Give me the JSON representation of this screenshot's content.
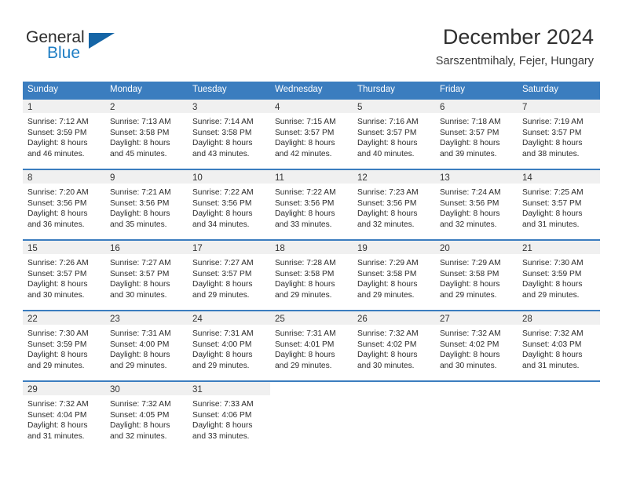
{
  "brand": {
    "name_part1": "General",
    "name_part2": "Blue",
    "logo_icon": "triangle-logo-icon",
    "accent_color": "#1f7ec4"
  },
  "header": {
    "title": "December 2024",
    "location": "Sarszentmihaly, Fejer, Hungary"
  },
  "colors": {
    "header_row_bg": "#3b7dbf",
    "day_band_bg": "#f0f0f0",
    "row_divider": "#3b7dbf",
    "text": "#2b2b2b"
  },
  "weekdays": [
    "Sunday",
    "Monday",
    "Tuesday",
    "Wednesday",
    "Thursday",
    "Friday",
    "Saturday"
  ],
  "weeks": [
    {
      "days": [
        {
          "date": "1",
          "sunrise": "Sunrise: 7:12 AM",
          "sunset": "Sunset: 3:59 PM",
          "daylight_l1": "Daylight: 8 hours",
          "daylight_l2": "and 46 minutes."
        },
        {
          "date": "2",
          "sunrise": "Sunrise: 7:13 AM",
          "sunset": "Sunset: 3:58 PM",
          "daylight_l1": "Daylight: 8 hours",
          "daylight_l2": "and 45 minutes."
        },
        {
          "date": "3",
          "sunrise": "Sunrise: 7:14 AM",
          "sunset": "Sunset: 3:58 PM",
          "daylight_l1": "Daylight: 8 hours",
          "daylight_l2": "and 43 minutes."
        },
        {
          "date": "4",
          "sunrise": "Sunrise: 7:15 AM",
          "sunset": "Sunset: 3:57 PM",
          "daylight_l1": "Daylight: 8 hours",
          "daylight_l2": "and 42 minutes."
        },
        {
          "date": "5",
          "sunrise": "Sunrise: 7:16 AM",
          "sunset": "Sunset: 3:57 PM",
          "daylight_l1": "Daylight: 8 hours",
          "daylight_l2": "and 40 minutes."
        },
        {
          "date": "6",
          "sunrise": "Sunrise: 7:18 AM",
          "sunset": "Sunset: 3:57 PM",
          "daylight_l1": "Daylight: 8 hours",
          "daylight_l2": "and 39 minutes."
        },
        {
          "date": "7",
          "sunrise": "Sunrise: 7:19 AM",
          "sunset": "Sunset: 3:57 PM",
          "daylight_l1": "Daylight: 8 hours",
          "daylight_l2": "and 38 minutes."
        }
      ]
    },
    {
      "days": [
        {
          "date": "8",
          "sunrise": "Sunrise: 7:20 AM",
          "sunset": "Sunset: 3:56 PM",
          "daylight_l1": "Daylight: 8 hours",
          "daylight_l2": "and 36 minutes."
        },
        {
          "date": "9",
          "sunrise": "Sunrise: 7:21 AM",
          "sunset": "Sunset: 3:56 PM",
          "daylight_l1": "Daylight: 8 hours",
          "daylight_l2": "and 35 minutes."
        },
        {
          "date": "10",
          "sunrise": "Sunrise: 7:22 AM",
          "sunset": "Sunset: 3:56 PM",
          "daylight_l1": "Daylight: 8 hours",
          "daylight_l2": "and 34 minutes."
        },
        {
          "date": "11",
          "sunrise": "Sunrise: 7:22 AM",
          "sunset": "Sunset: 3:56 PM",
          "daylight_l1": "Daylight: 8 hours",
          "daylight_l2": "and 33 minutes."
        },
        {
          "date": "12",
          "sunrise": "Sunrise: 7:23 AM",
          "sunset": "Sunset: 3:56 PM",
          "daylight_l1": "Daylight: 8 hours",
          "daylight_l2": "and 32 minutes."
        },
        {
          "date": "13",
          "sunrise": "Sunrise: 7:24 AM",
          "sunset": "Sunset: 3:56 PM",
          "daylight_l1": "Daylight: 8 hours",
          "daylight_l2": "and 32 minutes."
        },
        {
          "date": "14",
          "sunrise": "Sunrise: 7:25 AM",
          "sunset": "Sunset: 3:57 PM",
          "daylight_l1": "Daylight: 8 hours",
          "daylight_l2": "and 31 minutes."
        }
      ]
    },
    {
      "days": [
        {
          "date": "15",
          "sunrise": "Sunrise: 7:26 AM",
          "sunset": "Sunset: 3:57 PM",
          "daylight_l1": "Daylight: 8 hours",
          "daylight_l2": "and 30 minutes."
        },
        {
          "date": "16",
          "sunrise": "Sunrise: 7:27 AM",
          "sunset": "Sunset: 3:57 PM",
          "daylight_l1": "Daylight: 8 hours",
          "daylight_l2": "and 30 minutes."
        },
        {
          "date": "17",
          "sunrise": "Sunrise: 7:27 AM",
          "sunset": "Sunset: 3:57 PM",
          "daylight_l1": "Daylight: 8 hours",
          "daylight_l2": "and 29 minutes."
        },
        {
          "date": "18",
          "sunrise": "Sunrise: 7:28 AM",
          "sunset": "Sunset: 3:58 PM",
          "daylight_l1": "Daylight: 8 hours",
          "daylight_l2": "and 29 minutes."
        },
        {
          "date": "19",
          "sunrise": "Sunrise: 7:29 AM",
          "sunset": "Sunset: 3:58 PM",
          "daylight_l1": "Daylight: 8 hours",
          "daylight_l2": "and 29 minutes."
        },
        {
          "date": "20",
          "sunrise": "Sunrise: 7:29 AM",
          "sunset": "Sunset: 3:58 PM",
          "daylight_l1": "Daylight: 8 hours",
          "daylight_l2": "and 29 minutes."
        },
        {
          "date": "21",
          "sunrise": "Sunrise: 7:30 AM",
          "sunset": "Sunset: 3:59 PM",
          "daylight_l1": "Daylight: 8 hours",
          "daylight_l2": "and 29 minutes."
        }
      ]
    },
    {
      "days": [
        {
          "date": "22",
          "sunrise": "Sunrise: 7:30 AM",
          "sunset": "Sunset: 3:59 PM",
          "daylight_l1": "Daylight: 8 hours",
          "daylight_l2": "and 29 minutes."
        },
        {
          "date": "23",
          "sunrise": "Sunrise: 7:31 AM",
          "sunset": "Sunset: 4:00 PM",
          "daylight_l1": "Daylight: 8 hours",
          "daylight_l2": "and 29 minutes."
        },
        {
          "date": "24",
          "sunrise": "Sunrise: 7:31 AM",
          "sunset": "Sunset: 4:00 PM",
          "daylight_l1": "Daylight: 8 hours",
          "daylight_l2": "and 29 minutes."
        },
        {
          "date": "25",
          "sunrise": "Sunrise: 7:31 AM",
          "sunset": "Sunset: 4:01 PM",
          "daylight_l1": "Daylight: 8 hours",
          "daylight_l2": "and 29 minutes."
        },
        {
          "date": "26",
          "sunrise": "Sunrise: 7:32 AM",
          "sunset": "Sunset: 4:02 PM",
          "daylight_l1": "Daylight: 8 hours",
          "daylight_l2": "and 30 minutes."
        },
        {
          "date": "27",
          "sunrise": "Sunrise: 7:32 AM",
          "sunset": "Sunset: 4:02 PM",
          "daylight_l1": "Daylight: 8 hours",
          "daylight_l2": "and 30 minutes."
        },
        {
          "date": "28",
          "sunrise": "Sunrise: 7:32 AM",
          "sunset": "Sunset: 4:03 PM",
          "daylight_l1": "Daylight: 8 hours",
          "daylight_l2": "and 31 minutes."
        }
      ]
    },
    {
      "days": [
        {
          "date": "29",
          "sunrise": "Sunrise: 7:32 AM",
          "sunset": "Sunset: 4:04 PM",
          "daylight_l1": "Daylight: 8 hours",
          "daylight_l2": "and 31 minutes."
        },
        {
          "date": "30",
          "sunrise": "Sunrise: 7:32 AM",
          "sunset": "Sunset: 4:05 PM",
          "daylight_l1": "Daylight: 8 hours",
          "daylight_l2": "and 32 minutes."
        },
        {
          "date": "31",
          "sunrise": "Sunrise: 7:33 AM",
          "sunset": "Sunset: 4:06 PM",
          "daylight_l1": "Daylight: 8 hours",
          "daylight_l2": "and 33 minutes."
        },
        {
          "date": "",
          "sunrise": "",
          "sunset": "",
          "daylight_l1": "",
          "daylight_l2": ""
        },
        {
          "date": "",
          "sunrise": "",
          "sunset": "",
          "daylight_l1": "",
          "daylight_l2": ""
        },
        {
          "date": "",
          "sunrise": "",
          "sunset": "",
          "daylight_l1": "",
          "daylight_l2": ""
        },
        {
          "date": "",
          "sunrise": "",
          "sunset": "",
          "daylight_l1": "",
          "daylight_l2": ""
        }
      ]
    }
  ]
}
